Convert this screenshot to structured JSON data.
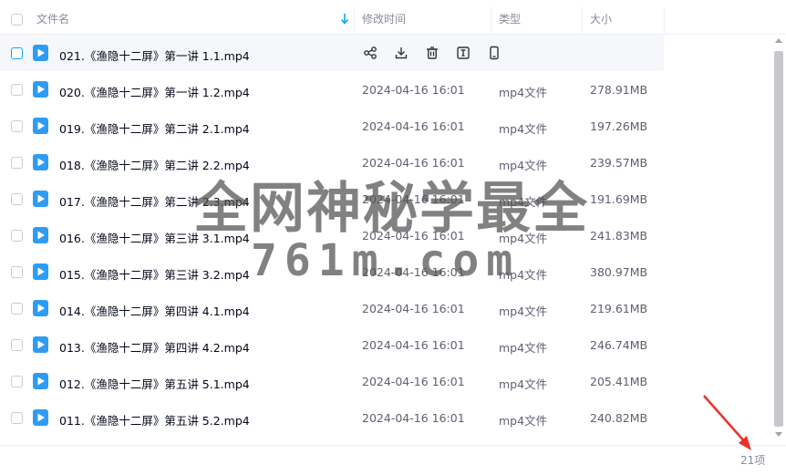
{
  "header": {
    "name_label": "文件名",
    "mtime_label": "修改时间",
    "type_label": "类型",
    "size_label": "大小"
  },
  "hover_actions": [
    "share-icon",
    "download-icon",
    "delete-icon",
    "rename-icon",
    "mobile-icon"
  ],
  "files": [
    {
      "name": "021.《渔隐十二屏》第一讲 1.1.mp4",
      "date": "",
      "type": "",
      "size": ""
    },
    {
      "name": "020.《渔隐十二屏》第一讲 1.2.mp4",
      "date": "2024-04-16 16:01",
      "type": "mp4文件",
      "size": "278.91MB"
    },
    {
      "name": "019.《渔隐十二屏》第二讲 2.1.mp4",
      "date": "2024-04-16 16:01",
      "type": "mp4文件",
      "size": "197.26MB"
    },
    {
      "name": "018.《渔隐十二屏》第二讲 2.2.mp4",
      "date": "2024-04-16 16:01",
      "type": "mp4文件",
      "size": "239.57MB"
    },
    {
      "name": "017.《渔隐十二屏》第二讲 2.3.mp4",
      "date": "2024-04-16 16:01",
      "type": "mp4文件",
      "size": "191.69MB"
    },
    {
      "name": "016.《渔隐十二屏》第三讲 3.1.mp4",
      "date": "2024-04-16 16:01",
      "type": "mp4文件",
      "size": "241.83MB"
    },
    {
      "name": "015.《渔隐十二屏》第三讲 3.2.mp4",
      "date": "2024-04-16 16:01",
      "type": "mp4文件",
      "size": "380.97MB"
    },
    {
      "name": "014.《渔隐十二屏》第四讲 4.1.mp4",
      "date": "2024-04-16 16:01",
      "type": "mp4文件",
      "size": "219.61MB"
    },
    {
      "name": "013.《渔隐十二屏》第四讲 4.2.mp4",
      "date": "2024-04-16 16:01",
      "type": "mp4文件",
      "size": "246.74MB"
    },
    {
      "name": "012.《渔隐十二屏》第五讲 5.1.mp4",
      "date": "2024-04-16 16:01",
      "type": "mp4文件",
      "size": "205.41MB"
    },
    {
      "name": "011.《渔隐十二屏》第五讲 5.2.mp4",
      "date": "2024-04-16 16:01",
      "type": "mp4文件",
      "size": "240.82MB"
    }
  ],
  "footer": {
    "count": "21项"
  },
  "watermark": {
    "line1": "全网神秘学最全",
    "line2": "761m.com"
  },
  "colors": {
    "accent": "#06a7ff",
    "file_icon": "#2e9cf3",
    "annotation_arrow": "#e8322b"
  }
}
